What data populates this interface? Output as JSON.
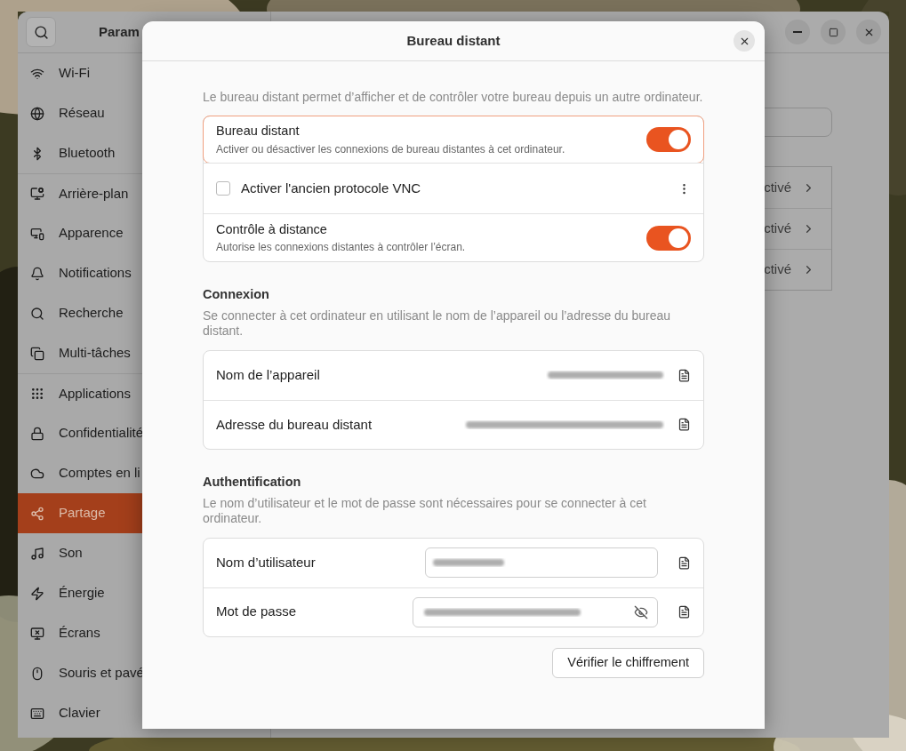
{
  "sidebar": {
    "header_title": "Param",
    "items": [
      {
        "label": "Wi-Fi",
        "selected": false
      },
      {
        "label": "Réseau",
        "selected": false
      },
      {
        "label": "Bluetooth",
        "selected": false
      },
      {
        "label": "Arrière-plan",
        "selected": false
      },
      {
        "label": "Apparence",
        "selected": false
      },
      {
        "label": "Notifications",
        "selected": false
      },
      {
        "label": "Recherche",
        "selected": false
      },
      {
        "label": "Multi-tâches",
        "selected": false
      },
      {
        "label": "Applications",
        "selected": false
      },
      {
        "label": "Confidentialité",
        "selected": false
      },
      {
        "label": "Comptes en li",
        "selected": false
      },
      {
        "label": "Partage",
        "selected": true
      },
      {
        "label": "Son",
        "selected": false
      },
      {
        "label": "Énergie",
        "selected": false
      },
      {
        "label": "Écrans",
        "selected": false
      },
      {
        "label": "Souris et pavé",
        "selected": false
      },
      {
        "label": "Clavier",
        "selected": false
      }
    ]
  },
  "main": {
    "rows": [
      {
        "status": "ctivé"
      },
      {
        "status": "ctivé"
      },
      {
        "status": "ctivé"
      }
    ]
  },
  "dialog": {
    "title": "Bureau distant",
    "intro": "Le bureau distant permet d’afficher et de contrôler votre bureau depuis un autre ordinateur.",
    "options": [
      {
        "kind": "switch",
        "title": "Bureau distant",
        "subtitle": "Activer ou désactiver les connexions de bureau distantes à cet ordinateur.",
        "on": true,
        "focused": true
      },
      {
        "kind": "checkbox",
        "title": "Activer l'ancien protocole VNC",
        "checked": false,
        "focused": false
      },
      {
        "kind": "switch",
        "title": "Contrôle à distance",
        "subtitle": "Autorise les connexions distantes à contrôler l’écran.",
        "on": true,
        "focused": false
      }
    ],
    "connection": {
      "heading": "Connexion",
      "description": "Se connecter à cet ordinateur en utilisant le nom de l’appareil ou l’adresse du bureau distant.",
      "rows": [
        {
          "label": "Nom de l’appareil"
        },
        {
          "label": "Adresse du bureau distant"
        }
      ]
    },
    "auth": {
      "heading": "Authentification",
      "description": "Le nom d’utilisateur et le mot de passe sont nécessaires pour se connecter à cet ordinateur.",
      "rows": [
        {
          "kind": "text",
          "label": "Nom d’utilisateur"
        },
        {
          "kind": "password",
          "label": "Mot de passe"
        }
      ]
    },
    "verify_button": "Vérifier le chiffrement"
  }
}
